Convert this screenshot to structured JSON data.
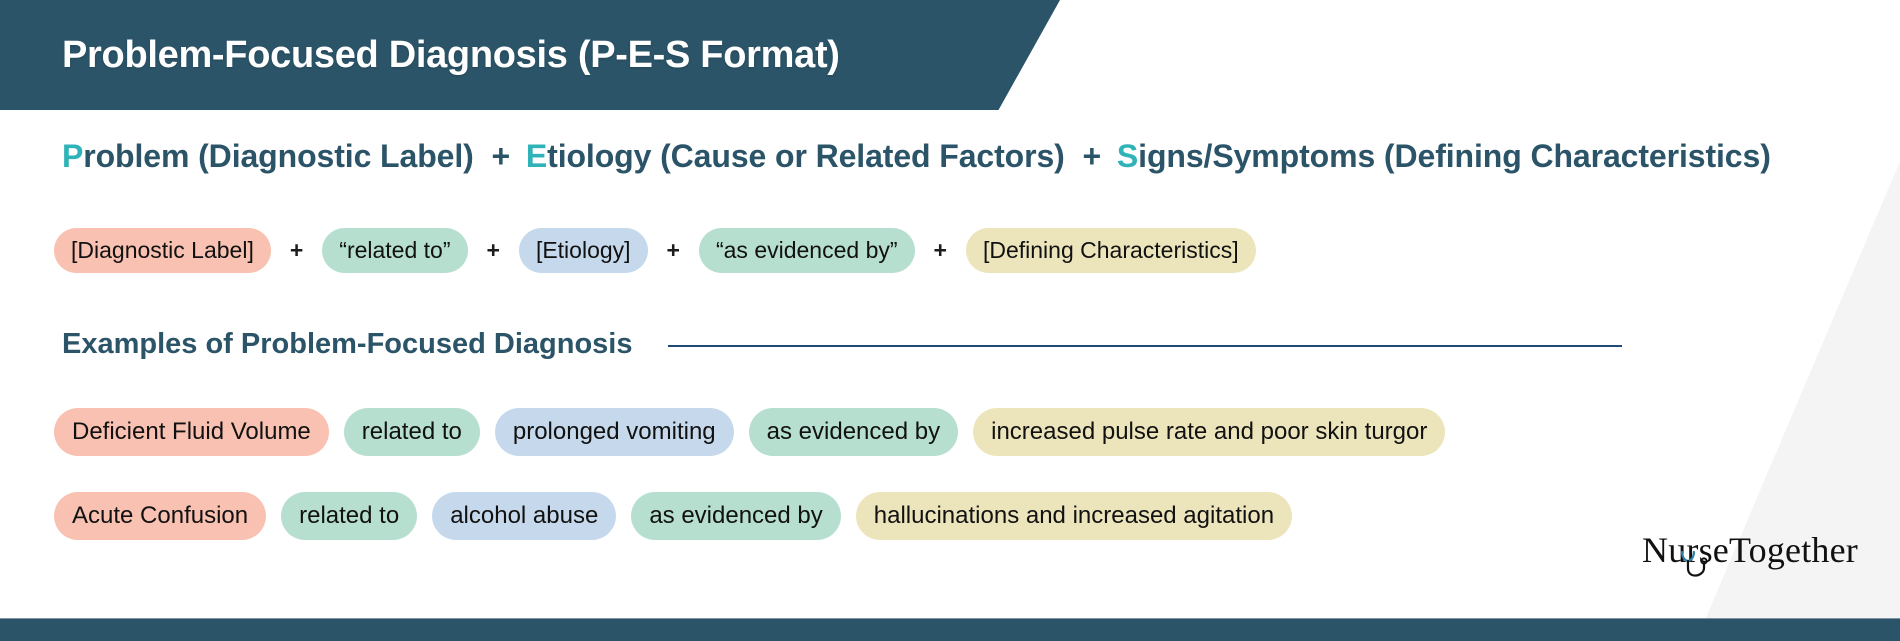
{
  "header": {
    "title": "Problem-Focused Diagnosis (P-E-S Format)",
    "background_color": "#2b5468",
    "text_color": "#ffffff"
  },
  "formula": {
    "accent_color": "#2fb3b8",
    "text_color": "#2b5468",
    "parts": [
      {
        "initial": "P",
        "rest": "roblem  (Diagnostic Label)"
      },
      {
        "initial": "E",
        "rest": "tiology (Cause or Related Factors)"
      },
      {
        "initial": "S",
        "rest": "igns/Symptoms (Defining Characteristics)"
      }
    ],
    "separator": "+",
    "full_text": "Problem  (Diagnostic Label) + Etiology (Cause or Related Factors) + Signs/Symptoms (Defining Characteristics)"
  },
  "template_row": {
    "separator": "+",
    "pills": [
      {
        "label": "[Diagnostic Label]",
        "color": "#f9c1b1",
        "role": "problem"
      },
      {
        "label": "“related to”",
        "color": "#b6dfd0",
        "role": "connector"
      },
      {
        "label": "[Etiology]",
        "color": "#c6d9ec",
        "role": "etiology"
      },
      {
        "label": "“as evidenced by”",
        "color": "#b6dfd0",
        "role": "connector"
      },
      {
        "label": "[Defining Characteristics]",
        "color": "#ece5bb",
        "role": "signs"
      }
    ]
  },
  "examples_section": {
    "heading": "Examples of Problem-Focused Diagnosis",
    "rule_color": "#1f4a75",
    "rows": [
      {
        "pills": [
          {
            "label": "Deficient Fluid Volume",
            "color": "#f9c1b1",
            "role": "problem"
          },
          {
            "label": "related to",
            "color": "#b6dfd0",
            "role": "connector"
          },
          {
            "label": "prolonged vomiting",
            "color": "#c6d9ec",
            "role": "etiology"
          },
          {
            "label": "as evidenced by",
            "color": "#b6dfd0",
            "role": "connector"
          },
          {
            "label": "increased pulse rate and poor skin turgor",
            "color": "#ece5bb",
            "role": "signs"
          }
        ]
      },
      {
        "pills": [
          {
            "label": "Acute Confusion",
            "color": "#f9c1b1",
            "role": "problem"
          },
          {
            "label": "related to",
            "color": "#b6dfd0",
            "role": "connector"
          },
          {
            "label": "alcohol abuse",
            "color": "#c6d9ec",
            "role": "etiology"
          },
          {
            "label": "as evidenced by",
            "color": "#b6dfd0",
            "role": "connector"
          },
          {
            "label": "hallucinations and increased agitation",
            "color": "#ece5bb",
            "role": "signs"
          }
        ]
      }
    ]
  },
  "logo": {
    "text": "NurseTogether",
    "icon": "stethoscope-icon"
  },
  "footer": {
    "background_color": "#2b5468"
  }
}
